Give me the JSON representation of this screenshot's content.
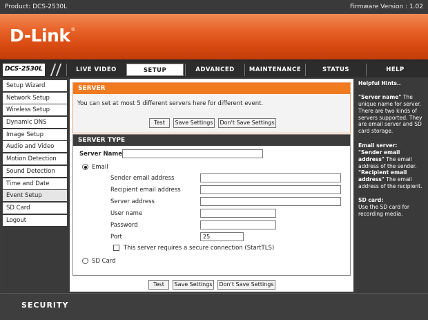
{
  "topbar": {
    "product": "Product: DCS-2530L",
    "firmware": "Firmware Version : 1.02"
  },
  "brand": {
    "logo": "D-Link",
    "mark": "®"
  },
  "nav": {
    "model": "DCS-2530L",
    "tabs": [
      "LIVE VIDEO",
      "SETUP",
      "ADVANCED",
      "MAINTENANCE",
      "STATUS",
      "HELP"
    ],
    "active_tab": "SETUP"
  },
  "sidebar": {
    "items": [
      "Setup Wizard",
      "Network Setup",
      "Wireless Setup",
      "Dynamic DNS",
      "Image Setup",
      "Audio and Video",
      "Motion Detection",
      "Sound Detection",
      "Time and Date",
      "Event Setup",
      "SD Card",
      "Logout"
    ],
    "active_item": "Event Setup"
  },
  "server_section": {
    "title": "SERVER",
    "description": "You can set at most 5 different servers here for different event.",
    "buttons": {
      "test": "Test",
      "save": "Save Settings",
      "dont_save": "Don't Save Settings"
    }
  },
  "server_type": {
    "title": "SERVER TYPE",
    "server_name_label": "Server Name:",
    "server_name_value": "",
    "email_radio_label": "Email",
    "email_selected": true,
    "fields": {
      "sender_label": "Sender email address",
      "sender_value": "",
      "recipient_label": "Recipient email address",
      "recipient_value": "",
      "server_address_label": "Server address",
      "server_address_value": "",
      "username_label": "User name",
      "username_value": "",
      "password_label": "Password",
      "password_value": "",
      "port_label": "Port",
      "port_value": "25"
    },
    "secure_label": "This server requires a secure connection (StartTLS)",
    "secure_checked": false,
    "sdcard_radio_label": "SD Card",
    "sdcard_selected": false
  },
  "bottom_buttons": {
    "test": "Test",
    "save": "Save Settings",
    "dont_save": "Don't Save Settings"
  },
  "hints": {
    "title": "Helpful Hints..",
    "p1_bold": "\"Server name\"",
    "p1_text": " The unique name for server. There are two kinds of servers supported. They are email server and SD card storage.",
    "p2_title": "Email server:",
    "p2_b1": "\"Sender email address\"",
    "p2_t1": " The email address of the sender.",
    "p2_b2": "\"Recipient email address\"",
    "p2_t2": " The email address of the recipient.",
    "p3_title": "SD card:",
    "p3_text": "Use the SD card for recording media."
  },
  "footer": {
    "label": "SECURITY"
  },
  "colors": {
    "accent_orange": "#ef7a1f",
    "dark_bg": "#3a3a3a",
    "banner_orange": "#e8642a"
  }
}
